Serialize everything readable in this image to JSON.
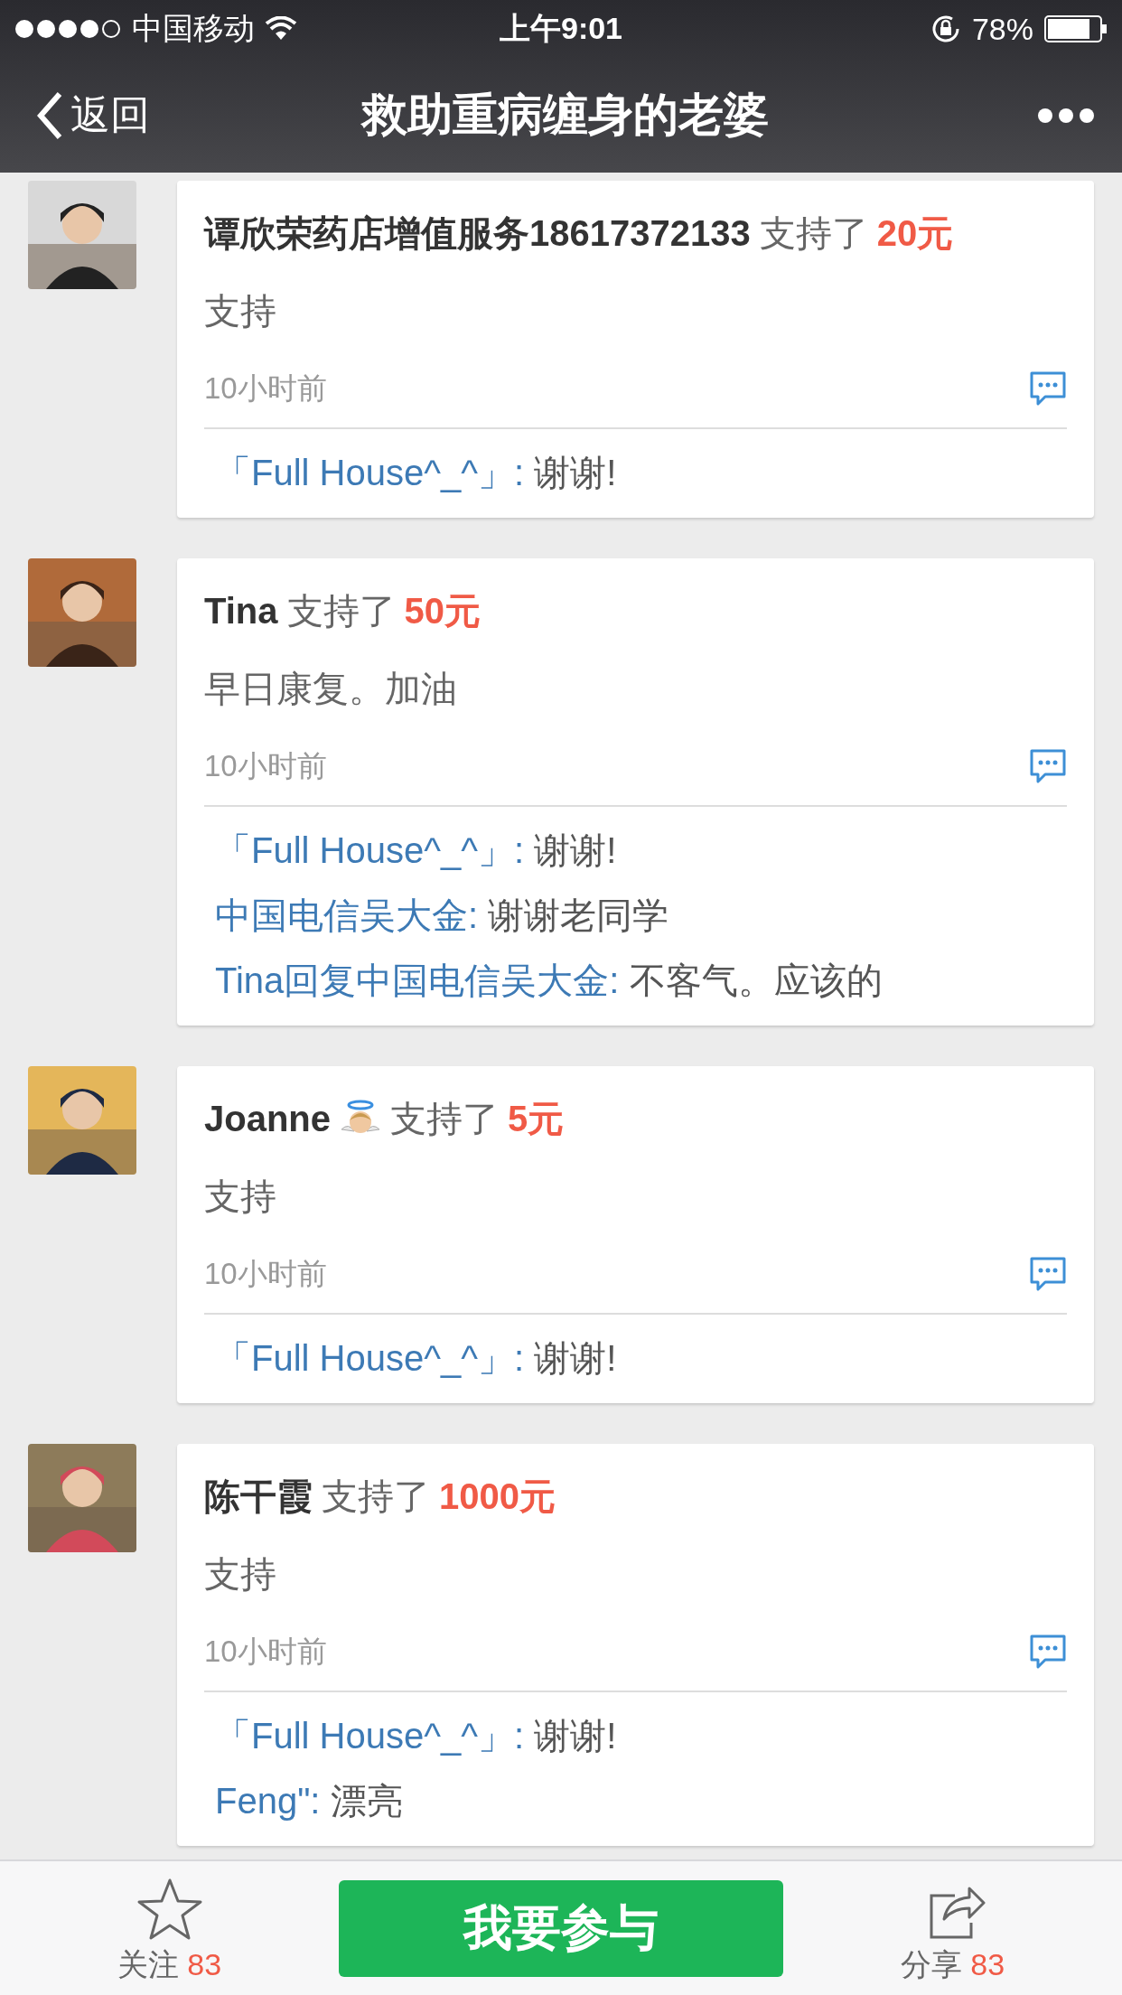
{
  "status_bar": {
    "carrier": "中国移动",
    "time": "上午9:01",
    "battery": "78%"
  },
  "nav": {
    "back": "返回",
    "title": "救助重病缠身的老婆"
  },
  "posts": [
    {
      "name": "谭欣荣药店增值服务18617372133",
      "badge": false,
      "action": "支持了",
      "amount": "20元",
      "message": "支持",
      "time": "10小时前",
      "replies": [
        {
          "name": "「Full House^_^」:",
          "text": "谢谢!"
        }
      ]
    },
    {
      "name": "Tina",
      "badge": false,
      "action": "支持了",
      "amount": "50元",
      "message": "早日康复。加油",
      "time": "10小时前",
      "replies": [
        {
          "name": "「Full House^_^」:",
          "text": "谢谢!"
        },
        {
          "name": "中国电信吴大金:",
          "text": "谢谢老同学"
        },
        {
          "name": "Tina回复中国电信吴大金:",
          "text": "不客气。应该的"
        }
      ]
    },
    {
      "name": "Joanne",
      "badge": true,
      "action": "支持了",
      "amount": "5元",
      "message": "支持",
      "time": "10小时前",
      "replies": [
        {
          "name": "「Full House^_^」:",
          "text": "谢谢!"
        }
      ]
    },
    {
      "name": "陈干霞",
      "badge": false,
      "action": "支持了",
      "amount": "1000元",
      "message": "支持",
      "time": "10小时前",
      "replies": [
        {
          "name": "「Full House^_^」:",
          "text": "谢谢!"
        },
        {
          "name": "Feng\":",
          "text": "漂亮"
        }
      ]
    }
  ],
  "bottom_bar": {
    "follow_label": "关注",
    "follow_count": "83",
    "join": "我要参与",
    "share_label": "分享",
    "share_count": "83"
  }
}
